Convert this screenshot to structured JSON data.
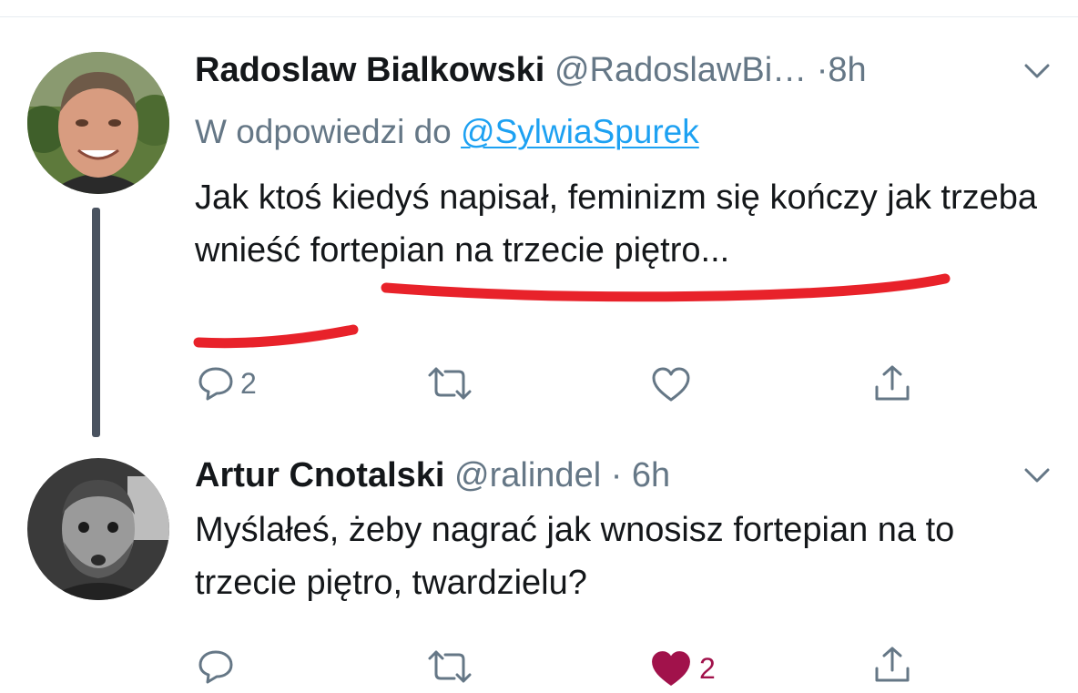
{
  "tweets": [
    {
      "display_name": "Radoslaw Bialkowski",
      "handle": "@RadoslawBi…",
      "separator": "·",
      "time": "8h",
      "reply_prefix": "W odpowiedzi do",
      "reply_to": "@SylwiaSpurek",
      "text": "Jak ktoś kiedyś napisał, feminizm się kończy jak trzeba wnieść fortepian na trzecie piętro...",
      "replies": "2",
      "likes": "",
      "liked": false
    },
    {
      "display_name": "Artur Cnotalski",
      "handle": "@ralindel",
      "separator": "·",
      "time": "6h",
      "text": "Myślałeś, żeby nagrać jak wnosisz fortepian na to trzecie piętro, twardzielu?",
      "replies": "",
      "likes": "2",
      "liked": true
    }
  ],
  "colors": {
    "primary_text": "#14171a",
    "secondary_text": "#657786",
    "link": "#1da1f2",
    "like_active": "#a1124b",
    "annotation_red": "#e8222a",
    "thread_line": "#4a5360"
  },
  "icons": {
    "reply": "speech-bubble",
    "retweet": "retweet-arrows",
    "like": "heart",
    "share": "upload-arrow",
    "menu": "chevron-down"
  }
}
